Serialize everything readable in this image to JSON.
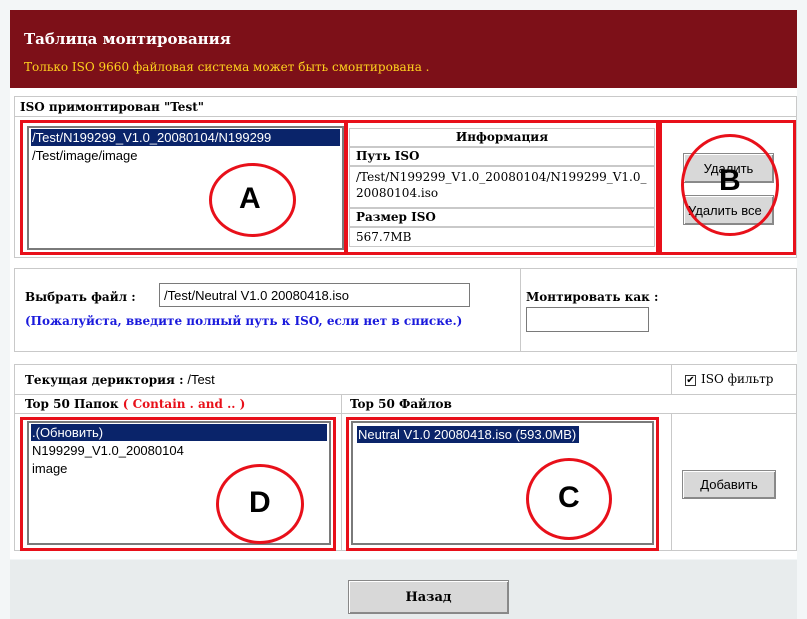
{
  "header": {
    "title": "Таблица монтирования",
    "subtitle": "Только ISO 9660 файловая система может быть смонтирована ."
  },
  "mounted": {
    "label": "ISO примонтирован \"Test\"",
    "items": [
      "/Test/N199299_V1.0_20080104/N199299",
      "/Test/image/image"
    ],
    "info_header": "Информация",
    "path_label": "Путь ISO",
    "path_value": "/Test/N199299_V1.0_20080104/N199299_V1.0_20080104.iso",
    "size_label": "Размер ISO",
    "size_value": "567.7MB",
    "delete_button": "Удалить",
    "delete_all_button": "Удалить все"
  },
  "select": {
    "file_label": "Выбрать файл :",
    "file_value": "/Test/Neutral V1.0 20080418.iso",
    "hint": "(Пожалуйста, введите полный путь к ISO, если нет в списке.)",
    "mount_as_label": "Монтировать как :",
    "mount_as_value": ""
  },
  "browser": {
    "current_dir_label": "Текущая дериктория :",
    "current_dir_value": "/Test",
    "iso_filter_label": "ISO фильтр",
    "iso_filter_checked": true,
    "folders_header": "Top 50 Папок",
    "folders_note": "( Contain . and .. )",
    "folders": [
      ".(Обновить)",
      "N199299_V1.0_20080104",
      "image"
    ],
    "files_header": "Top 50 Файлов",
    "files": [
      "Neutral V1.0 20080418.iso (593.0MB)"
    ],
    "add_button": "Добавить"
  },
  "annotations": {
    "a": "A",
    "b": "B",
    "c": "C",
    "d": "D",
    "color": "#e8101a"
  },
  "footer": {
    "back_button": "Назад"
  }
}
